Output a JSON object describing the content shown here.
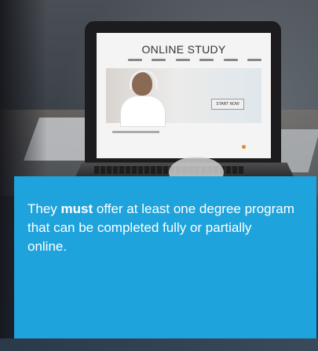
{
  "laptop_screen": {
    "site_title": "ONLINE STUDY",
    "hero_button": "START NOW"
  },
  "panel": {
    "text_before": "They ",
    "text_bold": "must",
    "text_after": " offer at least one degree program that can be completed fully or partially online.",
    "background_color": "#1fa3dc",
    "text_color": "#ffffff"
  },
  "icons": [
    "headphones-icon"
  ]
}
